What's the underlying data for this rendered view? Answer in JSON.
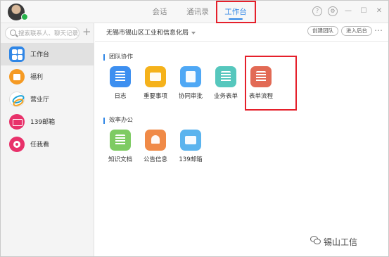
{
  "titlebar": {
    "tabs": [
      {
        "label": "会话"
      },
      {
        "label": "通讯录"
      },
      {
        "label": "工作台"
      }
    ],
    "icons": [
      "help-icon",
      "settings-icon",
      "minimize-icon",
      "maximize-icon",
      "close-icon"
    ],
    "accent_color": "#2f86e6"
  },
  "sidebar": {
    "search": {
      "placeholder": "搜索联系人、聊天记录"
    },
    "items": [
      {
        "label": "工作台"
      },
      {
        "label": "福利"
      },
      {
        "label": "营业厅"
      },
      {
        "label": "139邮箱"
      },
      {
        "label": "任我看"
      }
    ]
  },
  "main": {
    "org_name": "无锡市锡山区工业和信息化局",
    "buttons": {
      "create_team": "创建团队",
      "enter_admin": "进入后台"
    },
    "sections": [
      {
        "title": "团队协作",
        "apps": [
          {
            "label": "日志",
            "color": "#3d8ff0"
          },
          {
            "label": "重要事项",
            "color": "#f5b21b"
          },
          {
            "label": "协同审批",
            "color": "#4fa8f5"
          },
          {
            "label": "业务表单",
            "color": "#56c7bd"
          },
          {
            "label": "表单流程",
            "color": "#e26a55"
          }
        ]
      },
      {
        "title": "效率办公",
        "apps": [
          {
            "label": "知识文档",
            "color": "#7ecb63"
          },
          {
            "label": "公告信息",
            "color": "#f08a47"
          },
          {
            "label": "139邮箱",
            "color": "#5bb4ee"
          }
        ]
      }
    ]
  },
  "highlight_color": "#e5202b",
  "watermark": {
    "text": "锡山工信"
  }
}
